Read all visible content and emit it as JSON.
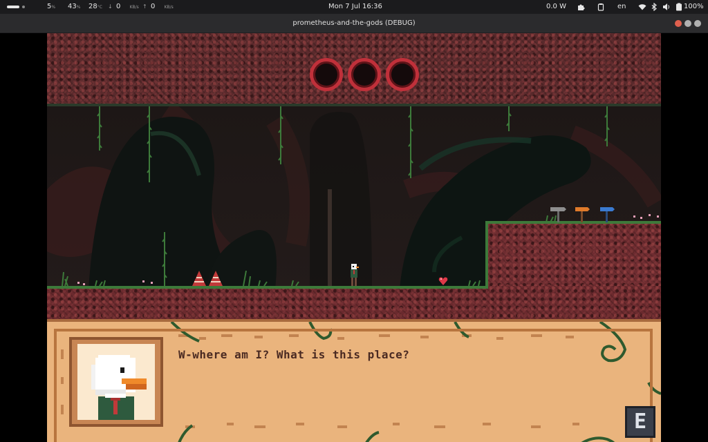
{
  "system_bar": {
    "cpu": "5",
    "cpu_unit": "%",
    "mem": "43",
    "mem_unit": "%",
    "temp": "28",
    "temp_unit": "°C",
    "net_down": "0",
    "net_down_unit": "KB/s",
    "net_up": "0",
    "net_up_unit": "KB/s",
    "clock": "Mon 7 Jul  16:36",
    "power": "0.0 W",
    "language": "en",
    "battery": "100%"
  },
  "window": {
    "title": "prometheus-and-the-gods (DEBUG)",
    "buttons": {
      "close": "#e0604e",
      "minimize": "#e3b341",
      "maximize": "#6dbb58"
    }
  },
  "hud": {
    "health_orbs": 3,
    "orb_color": "#c0303a"
  },
  "dialogue": {
    "text": "W-where am I? What is this place?",
    "continue_key": "E",
    "speaker_icon": "duck-portrait-icon"
  },
  "colors": {
    "rock": "#6b2a2e",
    "grass": "#3d7a3a",
    "dialog_bg": "#eab47d",
    "text": "#4a2a22"
  }
}
